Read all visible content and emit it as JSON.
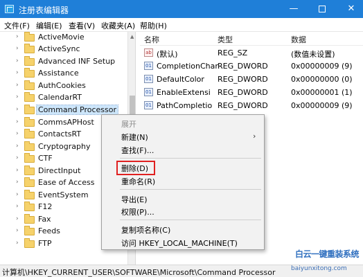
{
  "window": {
    "title": "注册表编辑器",
    "minimize_glyph": "—",
    "close_glyph": "✕"
  },
  "menubar": [
    "文件(F)",
    "编辑(E)",
    "查看(V)",
    "收藏夹(A)",
    "帮助(H)"
  ],
  "tree": {
    "items": [
      {
        "label": "ActiveMovie"
      },
      {
        "label": "ActiveSync"
      },
      {
        "label": "Advanced INF Setup"
      },
      {
        "label": "Assistance"
      },
      {
        "label": "AuthCookies"
      },
      {
        "label": "CalendarRT"
      },
      {
        "label": "Command Processor",
        "selected": true
      },
      {
        "label": "CommsAPHost"
      },
      {
        "label": "ContactsRT"
      },
      {
        "label": "Cryptography"
      },
      {
        "label": "CTF"
      },
      {
        "label": "DirectInput"
      },
      {
        "label": "Ease of Access"
      },
      {
        "label": "EventSystem"
      },
      {
        "label": "F12"
      },
      {
        "label": "Fax"
      },
      {
        "label": "Feeds"
      },
      {
        "label": "FTP"
      }
    ]
  },
  "list": {
    "headers": {
      "name": "名称",
      "type": "类型",
      "data": "数据"
    },
    "rows": [
      {
        "icon": "string-value-icon",
        "icon_text": "ab",
        "name": "(默认)",
        "type": "REG_SZ",
        "data": "(数值未设置)"
      },
      {
        "icon": "binary-value-icon",
        "icon_text": "01",
        "name": "CompletionChar",
        "type": "REG_DWORD",
        "data": "0x00000009 (9)"
      },
      {
        "icon": "binary-value-icon",
        "icon_text": "01",
        "name": "DefaultColor",
        "type": "REG_DWORD",
        "data": "0x00000000 (0)"
      },
      {
        "icon": "binary-value-icon",
        "icon_text": "01",
        "name": "EnableExtensi",
        "type": "REG_DWORD",
        "data": "0x00000001 (1)"
      },
      {
        "icon": "binary-value-icon",
        "icon_text": "01",
        "name": "PathCompletio",
        "type": "REG_DWORD",
        "data": "0x00000009 (9)"
      }
    ]
  },
  "context_menu": {
    "items": [
      {
        "label": "展开",
        "disabled": true
      },
      {
        "label": "新建(N)",
        "submenu": true,
        "submenu_glyph": "›"
      },
      {
        "label": "查找(F)..."
      },
      {
        "label": "删除(D)",
        "highlight": true
      },
      {
        "label": "重命名(R)"
      },
      {
        "label": "导出(E)"
      },
      {
        "label": "权限(P)..."
      },
      {
        "label": "复制项名称(C)"
      },
      {
        "label": "访问 HKEY_LOCAL_MACHINE(T)"
      }
    ]
  },
  "statusbar": {
    "path": "计算机\\HKEY_CURRENT_USER\\SOFTWARE\\Microsoft\\Command Processor"
  },
  "watermark": {
    "line1": "白云一键重装系统",
    "line2": "baiyunxitong.com"
  },
  "colors": {
    "titlebar": "#1f7fd8",
    "highlight_box": "#e02020",
    "selected_row": "#cde6fb"
  }
}
